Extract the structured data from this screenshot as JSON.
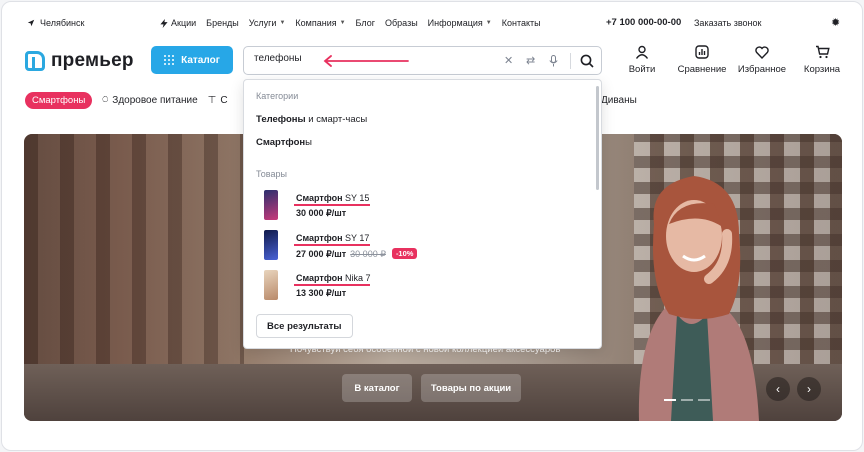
{
  "topbar": {
    "city": "Челябинск",
    "nav": [
      "Акции",
      "Бренды",
      "Услуги",
      "Компания",
      "Блог",
      "Образы",
      "Информация",
      "Контакты"
    ],
    "phone": "+7 100 000-00-00",
    "callback": "Заказать звонок"
  },
  "header": {
    "logo_text": "премьер",
    "catalog_label": "Каталог",
    "search_value": "телефоны",
    "actions": [
      "Войти",
      "Сравнение",
      "Избранное",
      "Корзина"
    ]
  },
  "categories": {
    "active": "Смартфоны",
    "items": [
      "Здоровое питание",
      "С"
    ],
    "right": "Диваны"
  },
  "hero": {
    "tagline": "Почувствуй себя особенной с новой коллекцией аксессуаров",
    "btn_catalog": "В каталог",
    "btn_sale": "Товары по акции"
  },
  "dropdown": {
    "categories_title": "Категории",
    "suggestions": [
      {
        "bold": "Телефоны",
        "rest": " и смарт-часы"
      },
      {
        "bold": "Смартфон",
        "rest": "ы"
      }
    ],
    "products_title": "Товары",
    "products": [
      {
        "bold": "Смартфон",
        "model": " SY 15",
        "price": "30 000 ₽/шт",
        "old": "",
        "badge": "",
        "color": "#7c3a84"
      },
      {
        "bold": "Смартфон",
        "model": " SY 17",
        "price": "27 000 ₽/шт",
        "old": "30 000 ₽",
        "badge": "-10%",
        "color": "#1e2a7a"
      },
      {
        "bold": "Смартфон",
        "model": " Nika 7",
        "price": "13 300 ₽/шт",
        "old": "",
        "badge": "",
        "color": "#c9a583"
      }
    ],
    "all_results": "Все результаты"
  },
  "colors": {
    "accent": "#27a7e7",
    "highlight": "#e8315f"
  }
}
